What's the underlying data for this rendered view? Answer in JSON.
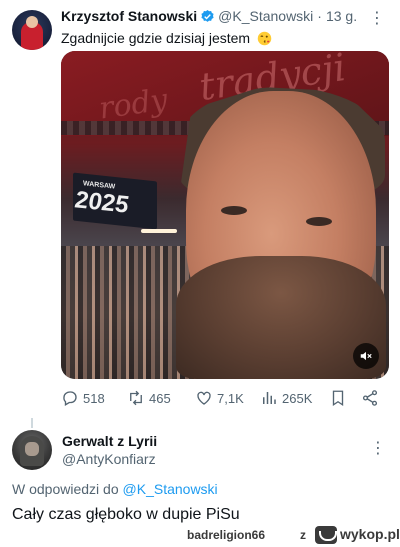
{
  "tweet": {
    "author_name": "Krzysztof Stanowski",
    "author_handle": "@K_Stanowski",
    "separator": "·",
    "time": "13 g.",
    "text": "Zgadnijcie gdzie dzisiaj jestem",
    "emoji_icon": "winking-face-kiss-icon",
    "media": {
      "banner_text": "tradycji",
      "banner_text2": "rody",
      "sign_small": "WARSAW",
      "sign_year": "2025"
    },
    "stats": {
      "replies": "518",
      "retweets": "465",
      "likes": "7,1K",
      "views": "265K"
    }
  },
  "reply": {
    "author_name": "Gerwalt z Lyrii",
    "author_handle": "@AntyKonfiarz",
    "replying_prefix": "W odpowiedzi do",
    "replying_to": "@K_Stanowski",
    "text": "Cały czas głęboko w dupie PiSu"
  },
  "footer": {
    "username": "badreligion66",
    "z": "z",
    "site": "wykop.pl"
  },
  "colors": {
    "accent": "#1d9bf0",
    "muted": "#536471",
    "text": "#0f1419"
  }
}
